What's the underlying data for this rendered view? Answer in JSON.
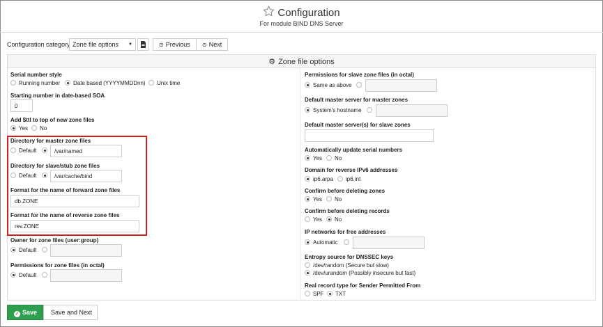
{
  "header": {
    "title": "Configuration",
    "subtitle": "For module BIND DNS Server"
  },
  "toolbar": {
    "category_label": "Configuration category",
    "category_value": "Zone file options",
    "previous_label": "Previous",
    "next_label": "Next"
  },
  "panel": {
    "title": "Zone file options"
  },
  "left": {
    "serial_style": {
      "label": "Serial number style",
      "options": [
        "Running number",
        "Date based (YYYYMMDDnn)",
        "Unix time"
      ],
      "selected": 1
    },
    "starting_number": {
      "label": "Starting number in date-based SOA",
      "value": "0"
    },
    "add_ttl": {
      "label": "Add $ttl to top of new zone files",
      "options": [
        "Yes",
        "No"
      ],
      "selected": 0
    },
    "master_dir": {
      "label": "Directory for master zone files",
      "default_label": "Default",
      "value": "/var/named"
    },
    "slave_dir": {
      "label": "Directory for slave/stub zone files",
      "default_label": "Default",
      "value": "/var/cache/bind"
    },
    "forward_format": {
      "label": "Format for the name of forward zone files",
      "value": "db.ZONE"
    },
    "reverse_format": {
      "label": "Format for the name of reverse zone files",
      "value": "rev.ZONE"
    },
    "owner": {
      "label": "Owner for zone files (user:group)",
      "default_label": "Default",
      "value": ""
    },
    "permissions": {
      "label": "Permissions for zone files (in octal)",
      "default_label": "Default",
      "value": ""
    }
  },
  "right": {
    "slave_perms": {
      "label": "Permissions for slave zone files (in octal)",
      "option": "Same as above",
      "value": ""
    },
    "default_master": {
      "label": "Default master server for master zones",
      "option": "System's hostname",
      "value": ""
    },
    "default_master_slave": {
      "label": "Default master server(s) for slave zones",
      "value": ""
    },
    "auto_serial": {
      "label": "Automatically update serial numbers",
      "options": [
        "Yes",
        "No"
      ],
      "selected": 0
    },
    "reverse_ipv6": {
      "label": "Domain for reverse IPv6 addresses",
      "options": [
        "ip6.arpa",
        "ip6.int"
      ],
      "selected": 0
    },
    "confirm_zones": {
      "label": "Confirm before deleting zones",
      "options": [
        "Yes",
        "No"
      ],
      "selected": 0
    },
    "confirm_records": {
      "label": "Confirm before deleting records",
      "options": [
        "Yes",
        "No"
      ],
      "selected": 1
    },
    "ip_networks": {
      "label": "IP networks for free addresses",
      "option": "Automatic",
      "value": ""
    },
    "entropy": {
      "label": "Entropy source for DNSSEC keys",
      "options": [
        "/dev/random (Secure but slow)",
        "/dev/urandom (Possibly insecure but fast)"
      ],
      "selected": 1
    },
    "spf_type": {
      "label": "Real record type for Sender Permitted From",
      "options": [
        "SPF",
        "TXT"
      ],
      "selected": 1
    }
  },
  "buttons": {
    "save": "Save",
    "save_next": "Save and Next"
  }
}
